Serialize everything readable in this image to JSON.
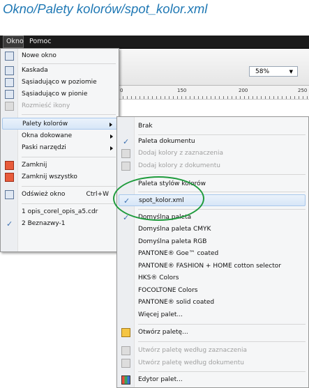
{
  "title": "Okno/Palety kolorów/spot_kolor.xml",
  "menubar": {
    "okno": "Okno",
    "pomoc": "Pomoc"
  },
  "zoom": {
    "value": "58%"
  },
  "ruler": {
    "labels": [
      "0",
      "150",
      "200",
      "250"
    ]
  },
  "okno_menu": {
    "items": [
      {
        "label": "Nowe okno",
        "icon": "new-window-icon"
      },
      {
        "label": "Kaskada",
        "icon": "cascade-icon"
      },
      {
        "label": "Sąsiadująco w poziomie",
        "icon": "tile-horizontal-icon"
      },
      {
        "label": "Sąsiadująco w pionie",
        "icon": "tile-vertical-icon"
      },
      {
        "label": "Rozmieść ikony",
        "icon": "arrange-icons-icon"
      },
      {
        "label": "Palety kolorów"
      },
      {
        "label": "Okna dokowane"
      },
      {
        "label": "Paski narzędzi"
      },
      {
        "label": "Zamknij",
        "icon": "close-window-icon"
      },
      {
        "label": "Zamknij wszystko",
        "icon": "close-all-icon"
      },
      {
        "label": "Odśwież okno",
        "shortcut": "Ctrl+W",
        "icon": "refresh-window-icon"
      },
      {
        "label": "1 opis_corel_opis_a5.cdr"
      },
      {
        "label": "2 Beznazwy-1",
        "checked": "✓"
      }
    ]
  },
  "palety_menu": {
    "items": [
      {
        "label": "Brak"
      },
      {
        "label": "Paleta dokumentu",
        "checked": "✓"
      },
      {
        "label": "Dodaj kolory z zaznaczenia"
      },
      {
        "label": "Dodaj kolory z dokumentu"
      },
      {
        "label": "Paleta stylów kolorów"
      },
      {
        "label": "spot_kolor.xml",
        "checked": "✓"
      },
      {
        "label": "Domyślna paleta",
        "checked": "✓"
      },
      {
        "label": "Domyślna paleta CMYK"
      },
      {
        "label": "Domyślna paleta RGB"
      },
      {
        "label": "PANTONE® Goe™ coated"
      },
      {
        "label": "PANTONE® FASHION + HOME cotton selector"
      },
      {
        "label": "HKS® Colors"
      },
      {
        "label": "FOCOLTONE Colors"
      },
      {
        "label": "PANTONE® solid coated"
      },
      {
        "label": "Więcej palet..."
      },
      {
        "label": "Otwórz paletę..."
      },
      {
        "label": "Utwórz paletę według zaznaczenia"
      },
      {
        "label": "Utwórz paletę według dokumentu"
      },
      {
        "label": "Edytor palet..."
      }
    ]
  },
  "colors": {
    "title": "#1f78b4",
    "highlight_ellipse": "#1e9b3c",
    "check": "#3a6fb0"
  }
}
